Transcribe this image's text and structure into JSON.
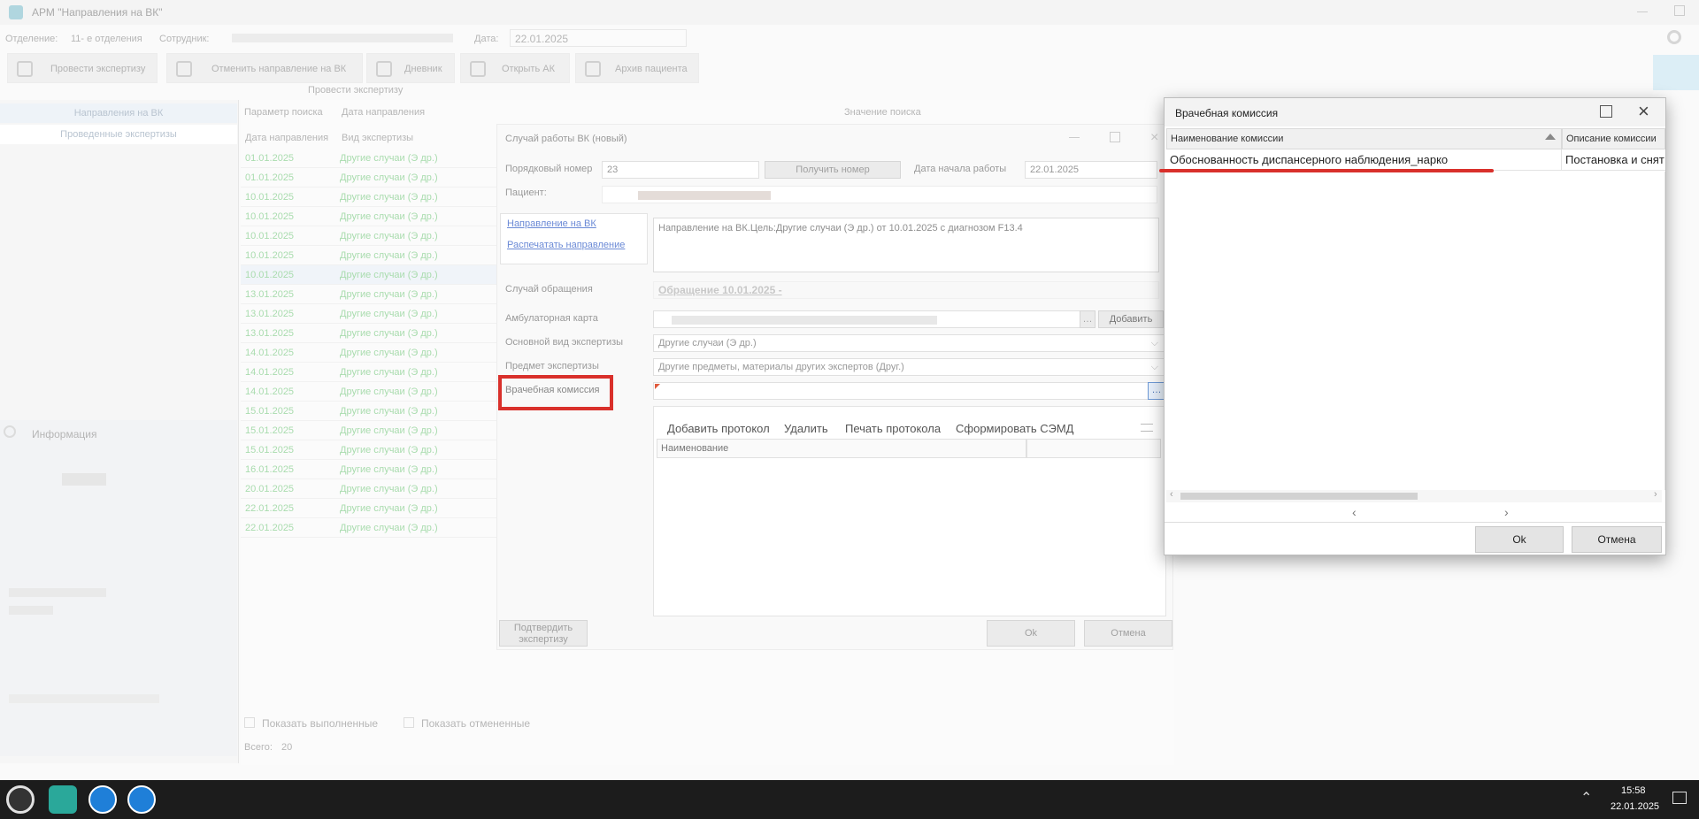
{
  "window": {
    "title": "АРМ \"Направления на ВК\""
  },
  "header": {
    "dept_label": "Отделение:",
    "dept_value": "11- е отделения",
    "employee_label": "Сотрудник:",
    "date_label": "Дата:",
    "date_value": "22.01.2025"
  },
  "toolbar": {
    "items": [
      "Провести экспертизу",
      "Отменить направление на ВК",
      "Дневник",
      "Открыть АК",
      "Архив пациента"
    ],
    "group_caption": "Провести экспертизу"
  },
  "left_panel": {
    "tabs": [
      "Направления на ВК",
      "Проведенные экспертизы"
    ],
    "info_title": "Информация"
  },
  "grid": {
    "search_param_label": "Параметр поиска",
    "search_param_value": "Дата направления",
    "search_value_label": "Значение поиска",
    "columns": [
      "Дата направления",
      "Вид экспертизы"
    ],
    "rows": [
      {
        "date": "01.01.2025",
        "type": "Другие случаи (Э др.)"
      },
      {
        "date": "01.01.2025",
        "type": "Другие случаи (Э др.)"
      },
      {
        "date": "10.01.2025",
        "type": "Другие случаи (Э др.)"
      },
      {
        "date": "10.01.2025",
        "type": "Другие случаи (Э др.)"
      },
      {
        "date": "10.01.2025",
        "type": "Другие случаи (Э др.)"
      },
      {
        "date": "10.01.2025",
        "type": "Другие случаи (Э др.)"
      },
      {
        "date": "10.01.2025",
        "type": "Другие случаи (Э др.)"
      },
      {
        "date": "13.01.2025",
        "type": "Другие случаи (Э др.)"
      },
      {
        "date": "13.01.2025",
        "type": "Другие случаи (Э др.)"
      },
      {
        "date": "13.01.2025",
        "type": "Другие случаи (Э др.)"
      },
      {
        "date": "14.01.2025",
        "type": "Другие случаи (Э др.)"
      },
      {
        "date": "14.01.2025",
        "type": "Другие случаи (Э др.)"
      },
      {
        "date": "14.01.2025",
        "type": "Другие случаи (Э др.)"
      },
      {
        "date": "15.01.2025",
        "type": "Другие случаи (Э др.)"
      },
      {
        "date": "15.01.2025",
        "type": "Другие случаи (Э др.)"
      },
      {
        "date": "15.01.2025",
        "type": "Другие случаи (Э др.)"
      },
      {
        "date": "16.01.2025",
        "type": "Другие случаи (Э др.)"
      },
      {
        "date": "20.01.2025",
        "type": "Другие случаи (Э др.)"
      },
      {
        "date": "22.01.2025",
        "type": "Другие случаи (Э др.)"
      },
      {
        "date": "22.01.2025",
        "type": "Другие случаи (Э др.)"
      }
    ],
    "show_done": "Показать выполненные",
    "show_cancelled": "Показать отмененные",
    "total_label": "Всего:",
    "total_value": "20"
  },
  "case_form": {
    "title": "Случай работы ВК (новый)",
    "order_label": "Порядковый номер",
    "order_value": "23",
    "get_number": "Получить номер",
    "start_date_label": "Дата начала работы",
    "start_date_value": "22.01.2025",
    "patient_label": "Пациент:",
    "link_direction": "Направление на ВК",
    "link_print": "Распечатать направление",
    "direction_text": "Направление на ВК.Цель:Другие случаи (Э др.) от 10.01.2025 с диагнозом F13.4",
    "case_label": "Случай обращения",
    "case_value": "Обращение 10.01.2025 -",
    "amb_card_label": "Амбулаторная карта",
    "add_button": "Добавить",
    "main_type_label": "Основной вид экспертизы",
    "main_type_value": "Другие случаи (Э др.)",
    "subject_label": "Предмет экспертизы",
    "subject_value": "Другие предметы, материалы других экспертов (Друг.)",
    "commission_label": "Врачебная комиссия",
    "protocol_actions": [
      "Добавить протокол",
      "Удалить",
      "Печать протокола",
      "Сформировать СЭМД"
    ],
    "protocol_col": "Наименование",
    "confirm_button": "Подтвердить экспертизу",
    "ok": "Ok",
    "cancel": "Отмена"
  },
  "dialog": {
    "title": "Врачебная комиссия",
    "col_name": "Наименование комиссии",
    "col_desc": "Описание комиссии",
    "row_name": "Обоснованность диспансерного наблюдения_нарко",
    "row_desc": "Постановка и снят",
    "ok": "Ok",
    "cancel": "Отмена"
  },
  "taskbar": {
    "time": "15:58",
    "date": "22.01.2025"
  },
  "colors": {
    "highlight_red": "#d9302b",
    "link_blue": "#6b8ad6",
    "grid_green": "#a9dcae"
  }
}
